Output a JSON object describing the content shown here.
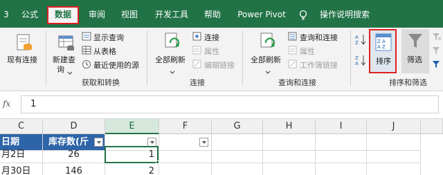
{
  "tabs": [
    {
      "label": "3",
      "active": false
    },
    {
      "label": "公式",
      "active": false
    },
    {
      "label": "数据",
      "active": true
    },
    {
      "label": "审阅",
      "active": false
    },
    {
      "label": "视图",
      "active": false
    },
    {
      "label": "开发工具",
      "active": false
    },
    {
      "label": "帮助",
      "active": false
    },
    {
      "label": "Power Pivot",
      "active": false
    },
    {
      "label": "操作说明搜索",
      "active": false
    }
  ],
  "ribbon": {
    "existing_conn": "现有连接",
    "new_query": "新建查",
    "new_query_2": "询",
    "show_query": "显示查询",
    "from_table": "从表格",
    "recent_sources": "最近使用的源",
    "get_transform_group": "获取和转换",
    "refresh_all_1": "全部刷新",
    "connections": "连接",
    "properties_1": "属性",
    "edit_links": "编辑链接",
    "connections_group": "连接",
    "refresh_all_2": "全部刷新",
    "queries_connections": "查询和连接",
    "properties_2": "属性",
    "workbook_links": "工作簿链接",
    "queries_group": "查询和连接",
    "sort": "排序",
    "filter": "筛选",
    "sort_filter_group": "排序和筛选"
  },
  "formula_bar": {
    "fx": "fx",
    "value": "1"
  },
  "columns": [
    "C",
    "D",
    "E",
    "F",
    "G",
    "H",
    "I",
    "J"
  ],
  "rows": [
    {
      "c": "日期",
      "d": "库存数(斤",
      "e": ""
    },
    {
      "c": "月2日",
      "d": "26",
      "e": "1"
    },
    {
      "c": "月30日",
      "d": "146",
      "e": "2"
    }
  ],
  "colors": {
    "accent": "#217346",
    "highlight": "#e02020",
    "header_fill": "#2e64a8"
  }
}
